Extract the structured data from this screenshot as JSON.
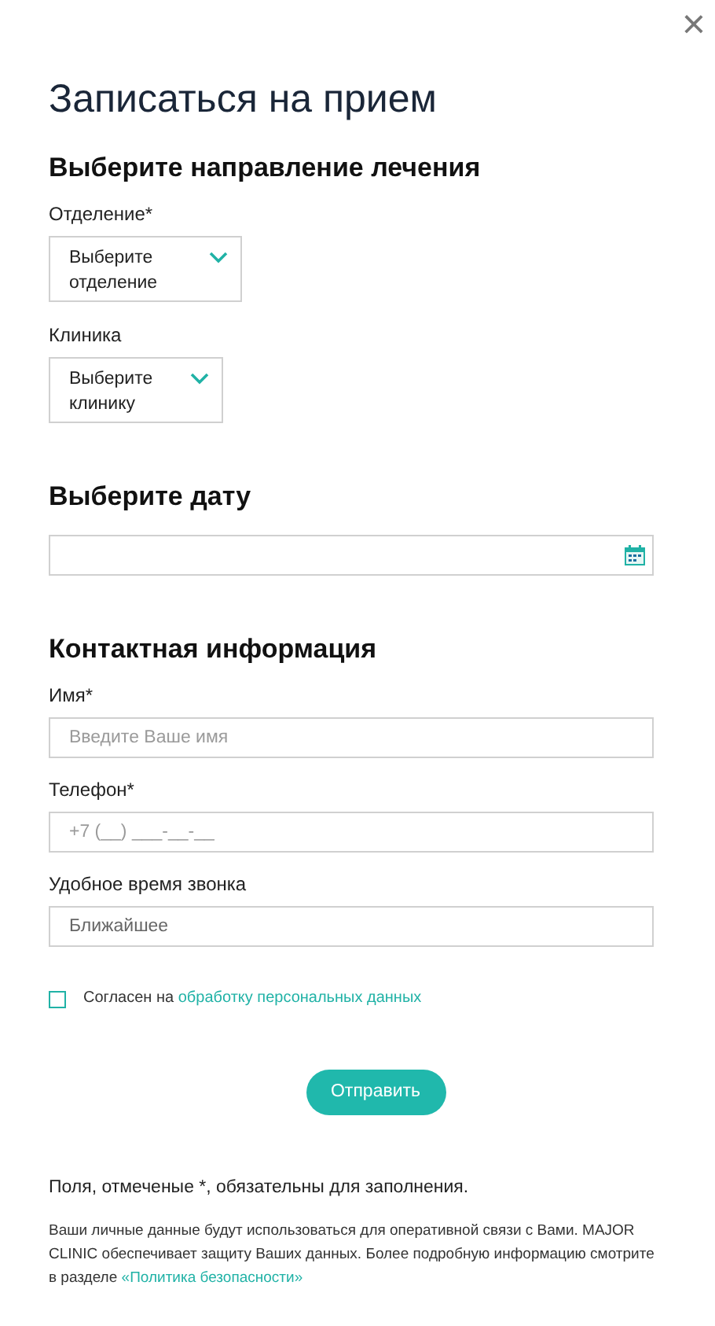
{
  "close_button": {
    "label": "×"
  },
  "title": "Записаться на прием",
  "direction_section": {
    "heading": "Выберите направление лечения",
    "selects": [
      {
        "label": "Отделение*",
        "value": "Выберите отделение"
      },
      {
        "label": "Клиника",
        "value": "Выберите клинику"
      }
    ]
  },
  "date_section": {
    "heading": "Выберите дату"
  },
  "contact_section": {
    "heading": "Контактная информация",
    "fields": [
      {
        "label": "Имя*",
        "placeholder": "Введите Ваше имя"
      },
      {
        "label": "Телефон*",
        "placeholder": "+7 (__) ___-__-__"
      },
      {
        "label": "Удобное время звонка",
        "value": "Ближайшее"
      }
    ]
  },
  "consent": {
    "checked": false,
    "text": "Согласен на",
    "link": "обработку персональных данных"
  },
  "submit_button": "Отправить",
  "required_note": "Поля, отмеченые *, обязательны для заполнения.",
  "privacy": {
    "text": "Ваши личные данные будут использоваться для оперативной связи с Вами. MAJOR CLINIC обеспечивает защиту Ваших данных. Более подробную информацию смотрите в разделе",
    "link": "«Политика безопасности»"
  }
}
